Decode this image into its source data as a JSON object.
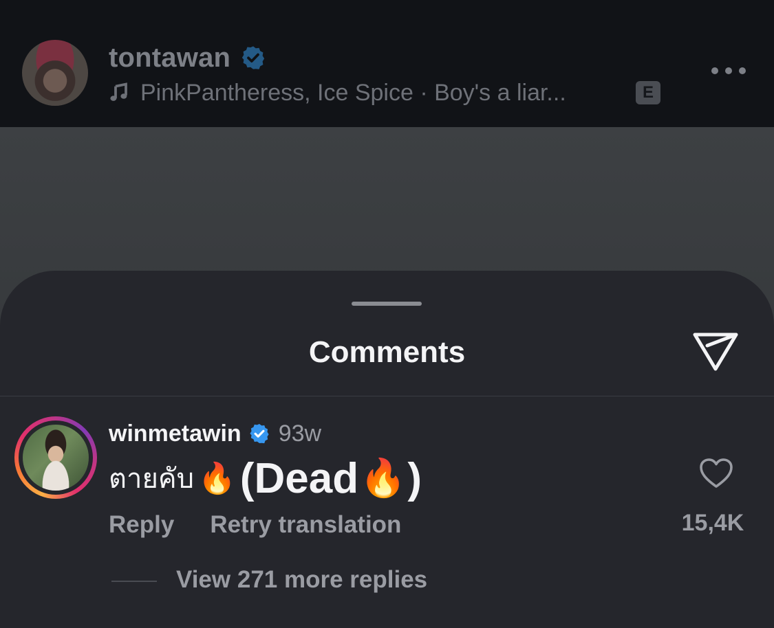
{
  "post": {
    "username": "tontawan",
    "audio": "PinkPantheress, Ice Spice · Boy's a liar...",
    "explicit_badge": "E",
    "icons": {
      "verified": "verified-badge-icon",
      "music": "music-note-icon",
      "more": "more-options-icon"
    }
  },
  "sheet": {
    "title": "Comments",
    "share_icon": "send-icon"
  },
  "comment": {
    "username": "winmetawin",
    "time": "93w",
    "text_thai": "ตายคับ",
    "text_open": "(Dead",
    "text_close": ")",
    "emoji": "🔥",
    "reply_label": "Reply",
    "translation_label": "Retry translation",
    "like_count": "15,4K",
    "view_replies_label": "View 271 more replies",
    "like_icon": "heart-icon"
  },
  "colors": {
    "sheet_background": "#25262c",
    "verified_blue": "#3797f0",
    "secondary_text": "#9a9ca3"
  }
}
